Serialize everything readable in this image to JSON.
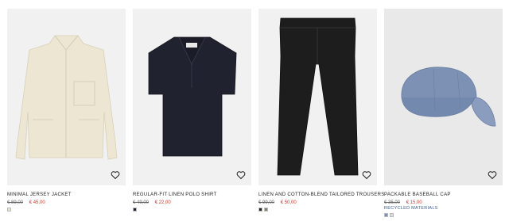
{
  "products": [
    {
      "name": "MINIMAL JERSEY JACKET",
      "old_price": "€ 89,00",
      "new_price": "€ 45,00",
      "tag": "",
      "swatches": [
        "#e9e4cf"
      ],
      "image": "cream-jacket"
    },
    {
      "name": "REGULAR-FIT LINEN POLO SHIRT",
      "old_price": "€ 49,00",
      "new_price": "€ 22,00",
      "tag": "",
      "swatches": [
        "#1f2233"
      ],
      "image": "navy-polo"
    },
    {
      "name": "LINEN AND COTTON-BLEND TAILORED TROUSERS",
      "old_price": "€ 99,00",
      "new_price": "€ 50,00",
      "tag": "",
      "swatches": [
        "#222222",
        "#8a7f6a"
      ],
      "image": "black-trousers"
    },
    {
      "name": "PACKABLE BASEBALL CAP",
      "old_price": "€ 35,00",
      "new_price": "€ 15,00",
      "tag": "RECYCLED MATERIALS",
      "swatches": [
        "#7c8fb3",
        "#dcdcdc"
      ],
      "image": "blue-cap"
    }
  ],
  "icons": {
    "wishlist": "heart-icon"
  },
  "colors": {
    "sale": "#d33a2c",
    "tag": "#3a5a8c",
    "image_bg": "#f0f0f0"
  }
}
